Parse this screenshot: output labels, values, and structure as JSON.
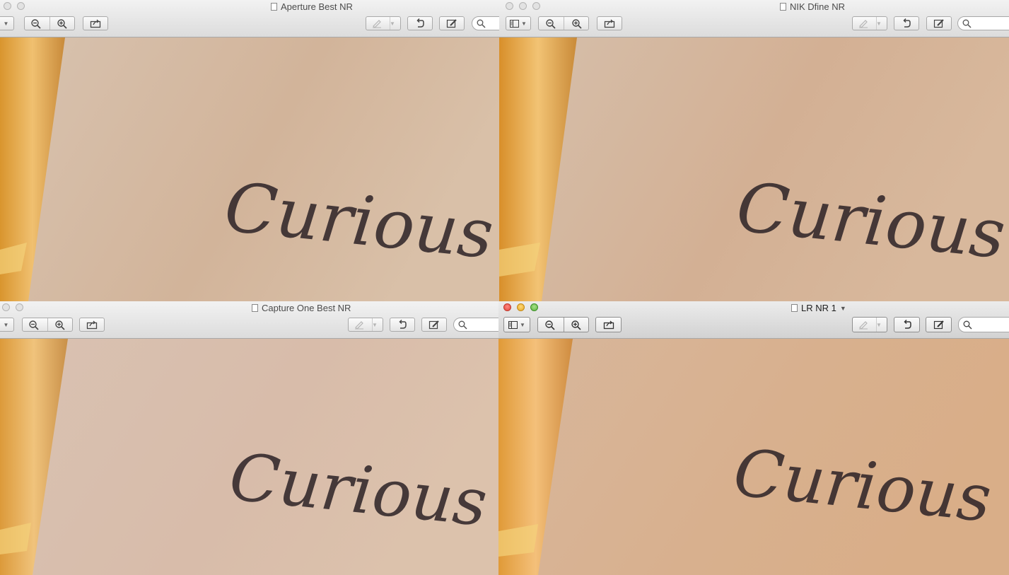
{
  "windows": [
    {
      "id": "aperture",
      "title": "Aperture Best NR",
      "focused": false
    },
    {
      "id": "nik",
      "title": "NIK Dfine NR",
      "focused": false
    },
    {
      "id": "capture-one",
      "title": "Capture One Best NR",
      "focused": false
    },
    {
      "id": "lightroom",
      "title": "LR NR 1",
      "focused": true
    }
  ],
  "photo": {
    "text": "Curious"
  },
  "toolbar": {
    "icons": [
      "sidebar-icon",
      "zoom-out-icon",
      "zoom-in-icon",
      "share-icon",
      "annotate-icon",
      "rotate-icon",
      "edit-icon",
      "search-icon"
    ]
  },
  "colors": {
    "close": "#e0443e",
    "minimize": "#e5a823",
    "zoom": "#5ab43a"
  }
}
